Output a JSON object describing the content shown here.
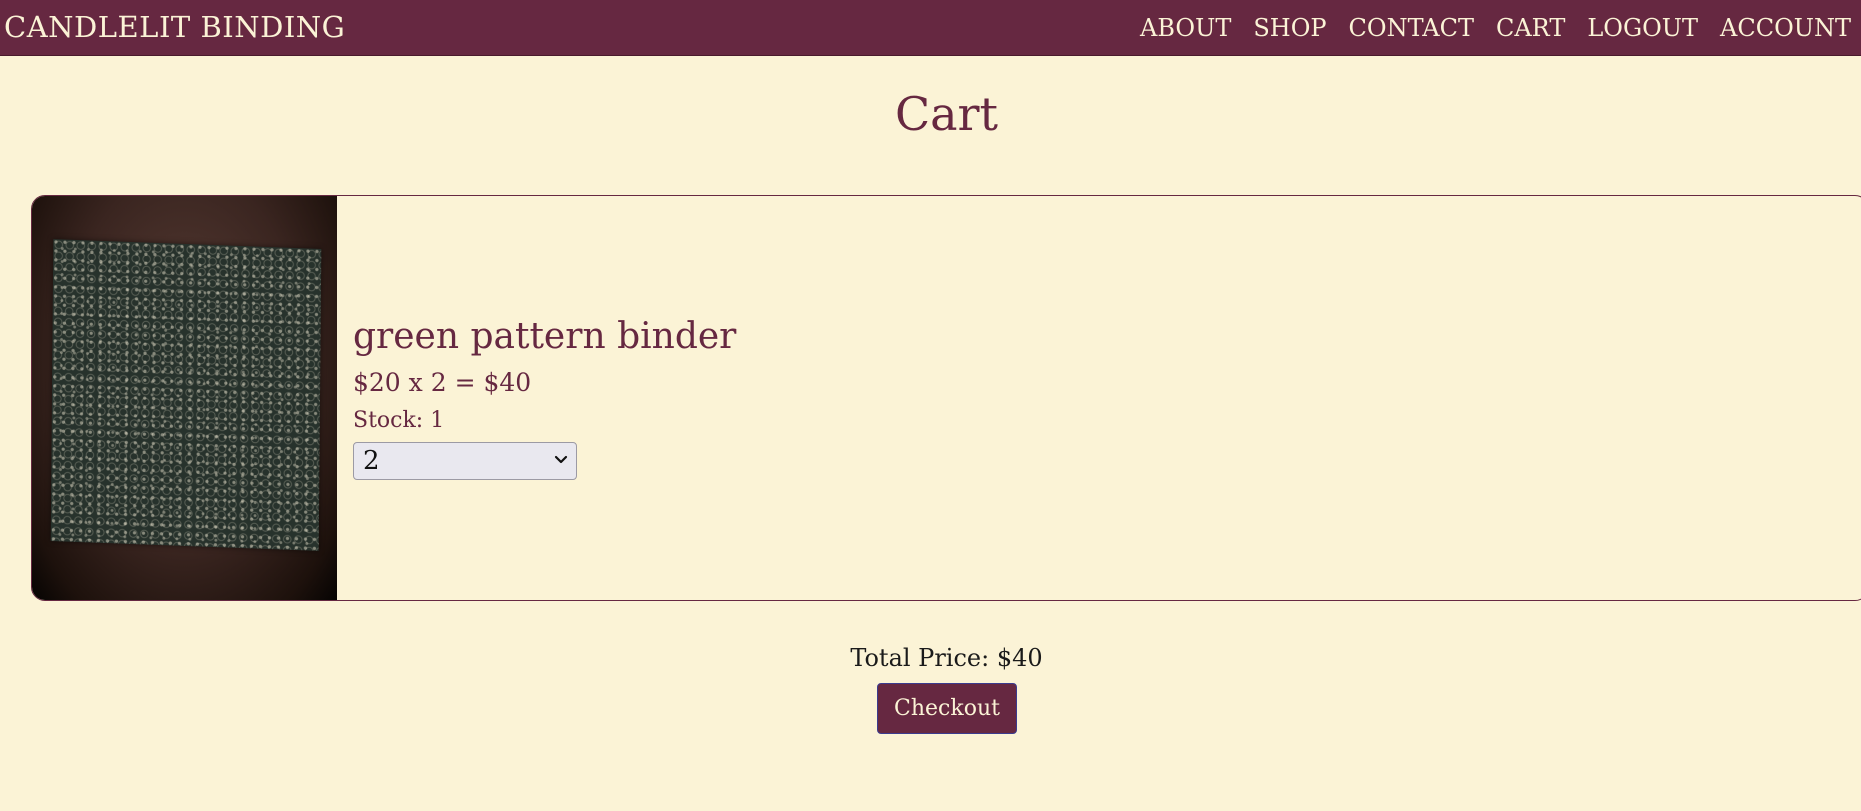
{
  "navbar": {
    "brand": "CANDLELIT BINDING",
    "links": [
      {
        "label": "ABOUT"
      },
      {
        "label": "SHOP"
      },
      {
        "label": "CONTACT"
      },
      {
        "label": "CART"
      },
      {
        "label": "LOGOUT"
      },
      {
        "label": "ACCOUNT"
      }
    ]
  },
  "page": {
    "title": "Cart"
  },
  "cart": {
    "items": [
      {
        "name": "green pattern binder",
        "price_line": "$20 x 2 = $40",
        "stock": "Stock: 1",
        "quantity": "2"
      }
    ],
    "total": "Total Price: $40",
    "checkout_label": "Checkout"
  },
  "colors": {
    "primary": "#662841",
    "background": "#fbf3d6",
    "text_dark": "#1a1a1a"
  }
}
